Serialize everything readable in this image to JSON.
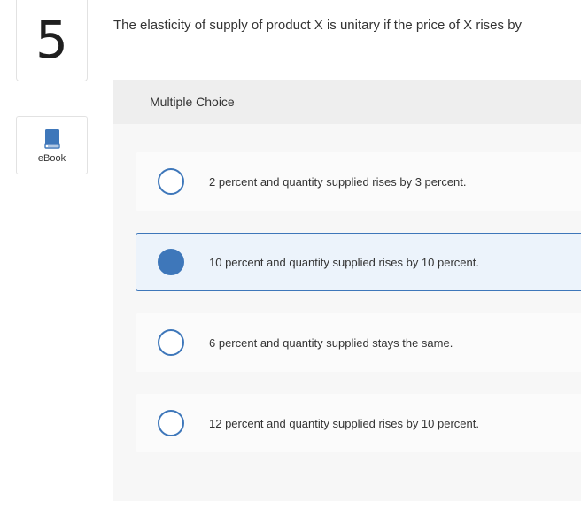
{
  "question": {
    "number": "5",
    "text": "The elasticity of supply of product X is unitary if the price of X rises by"
  },
  "ebook": {
    "label": "eBook",
    "icon": "book-icon",
    "icon_color": "#3e77ba"
  },
  "answer_panel": {
    "header": "Multiple Choice",
    "choices": [
      {
        "text": "2 percent and quantity supplied rises by 3 percent.",
        "selected": false
      },
      {
        "text": "10 percent and quantity supplied rises by 10 percent.",
        "selected": true
      },
      {
        "text": "6 percent and quantity supplied stays the same.",
        "selected": false
      },
      {
        "text": "12 percent and quantity supplied rises by 10 percent.",
        "selected": false
      }
    ]
  },
  "colors": {
    "accent": "#3e77ba",
    "selected_bg": "#ecf3fb",
    "panel_bg": "#f2f2f2"
  }
}
